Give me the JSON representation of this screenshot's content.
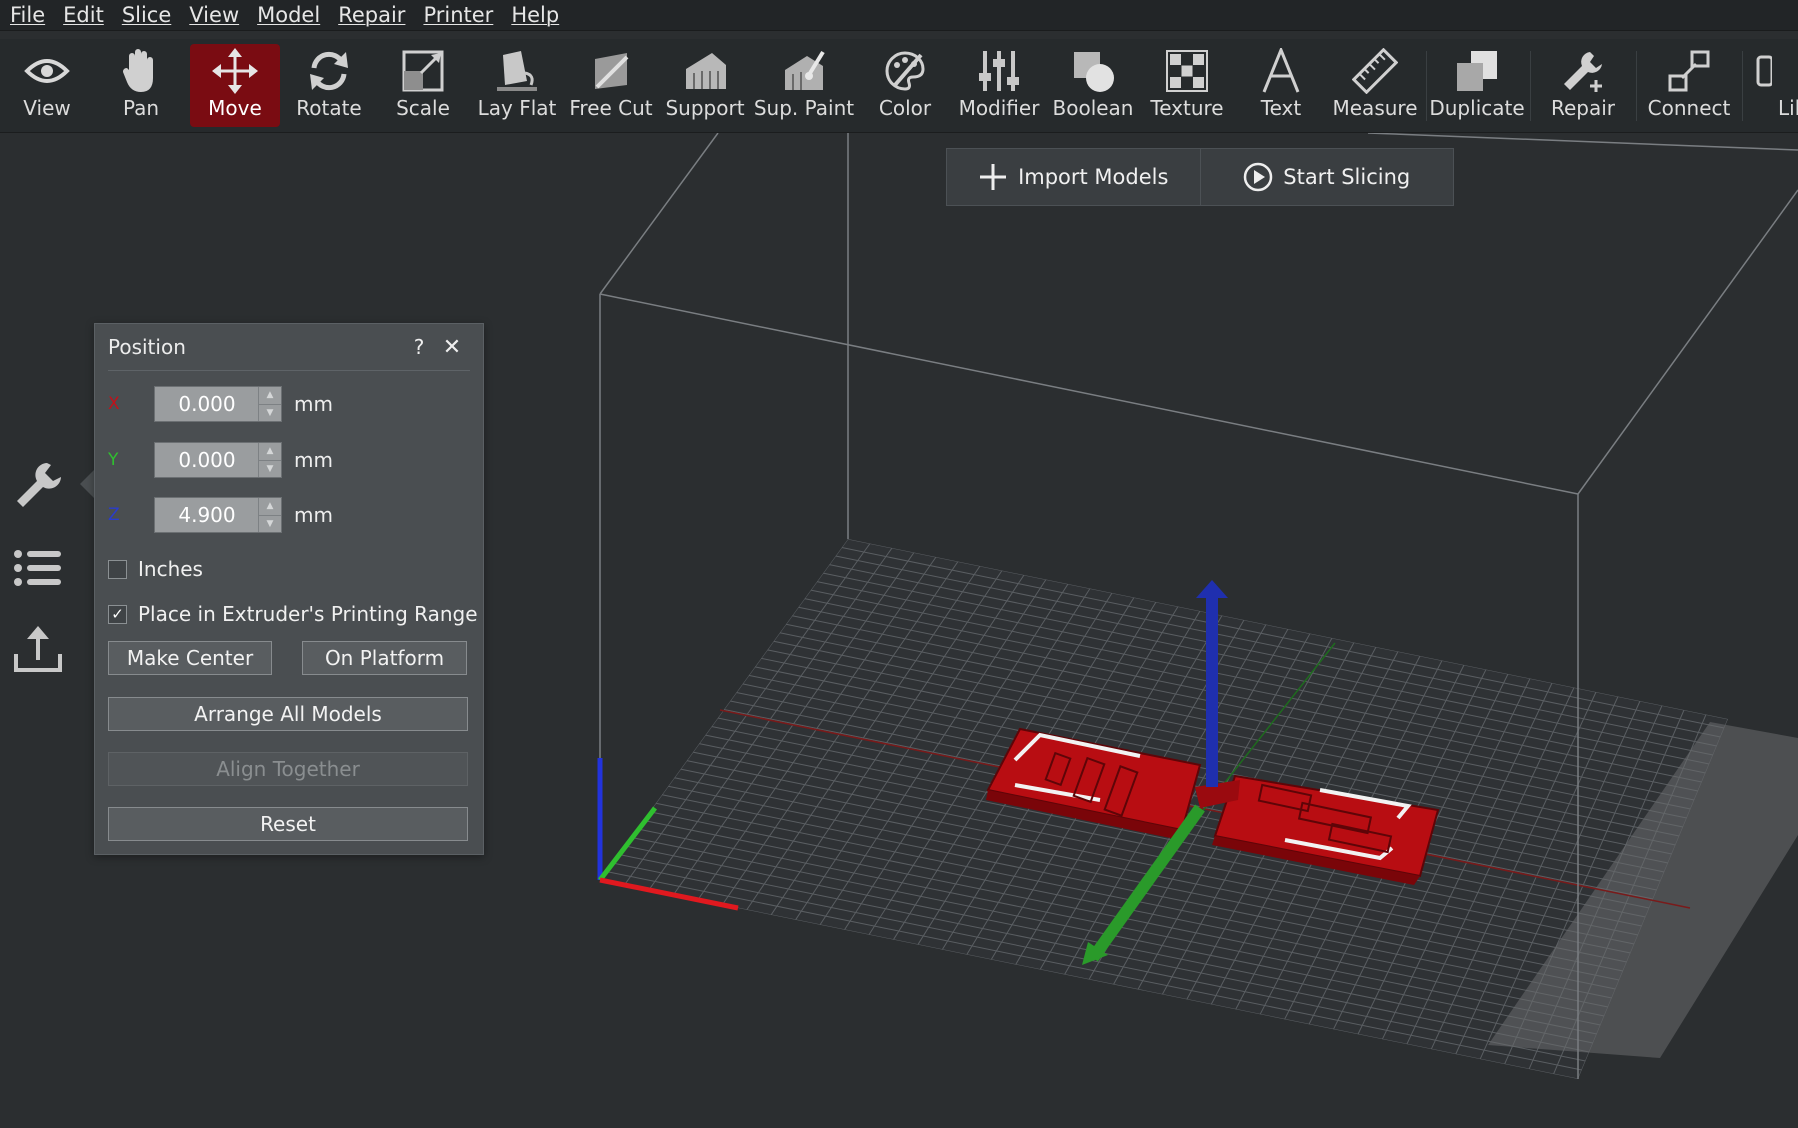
{
  "menu": [
    "File",
    "Edit",
    "Slice",
    "View",
    "Model",
    "Repair",
    "Printer",
    "Help"
  ],
  "toolbar": {
    "tools": [
      {
        "label": "View",
        "icon": "eye-icon"
      },
      {
        "label": "Pan",
        "icon": "hand-icon"
      },
      {
        "label": "Move",
        "icon": "move-arrows-icon",
        "active": true
      },
      {
        "label": "Rotate",
        "icon": "rotate-icon"
      },
      {
        "label": "Scale",
        "icon": "scale-icon"
      },
      {
        "label": "Lay Flat",
        "icon": "lay-flat-icon"
      },
      {
        "label": "Free Cut",
        "icon": "free-cut-icon"
      },
      {
        "label": "Support",
        "icon": "support-icon"
      },
      {
        "label": "Sup. Paint",
        "icon": "support-paint-icon"
      },
      {
        "label": "Color",
        "icon": "color-palette-icon"
      },
      {
        "label": "Modifier",
        "icon": "modifier-sliders-icon"
      },
      {
        "label": "Boolean",
        "icon": "boolean-icon"
      },
      {
        "label": "Texture",
        "icon": "texture-checker-icon"
      },
      {
        "label": "Text",
        "icon": "text-icon"
      },
      {
        "label": "Measure",
        "icon": "ruler-icon"
      },
      {
        "label": "Duplicate",
        "icon": "duplicate-icon"
      },
      {
        "label": "Repair",
        "icon": "wrench-icon"
      },
      {
        "label": "Connect",
        "icon": "connect-icon"
      },
      {
        "label": "Lib",
        "icon": "library-icon"
      }
    ],
    "active_color": "#7a0c12"
  },
  "actions": {
    "import_label": "Import Models",
    "slice_label": "Start Slicing"
  },
  "sidebar": [
    "wrench-icon",
    "list-icon",
    "export-icon"
  ],
  "position_panel": {
    "title": "Position",
    "help": "?",
    "close": "✕",
    "axes": [
      {
        "label": "X",
        "value": "0.000",
        "unit": "mm",
        "color": "#c1121a"
      },
      {
        "label": "Y",
        "value": "0.000",
        "unit": "mm",
        "color": "#2fbf2f"
      },
      {
        "label": "Z",
        "value": "4.900",
        "unit": "mm",
        "color": "#2a3ccc"
      }
    ],
    "inches": {
      "label": "Inches",
      "checked": false
    },
    "place_in_range": {
      "label": "Place in Extruder's Printing Range",
      "checked": true
    },
    "buttons": {
      "make_center": "Make Center",
      "on_platform": "On Platform",
      "arrange_all": "Arrange All Models",
      "align_together": "Align Together",
      "reset": "Reset"
    }
  },
  "colors": {
    "model_red": "#b80d12",
    "axis_x": "#e0191f",
    "axis_y": "#2fbf2f",
    "axis_z": "#2233dd"
  }
}
